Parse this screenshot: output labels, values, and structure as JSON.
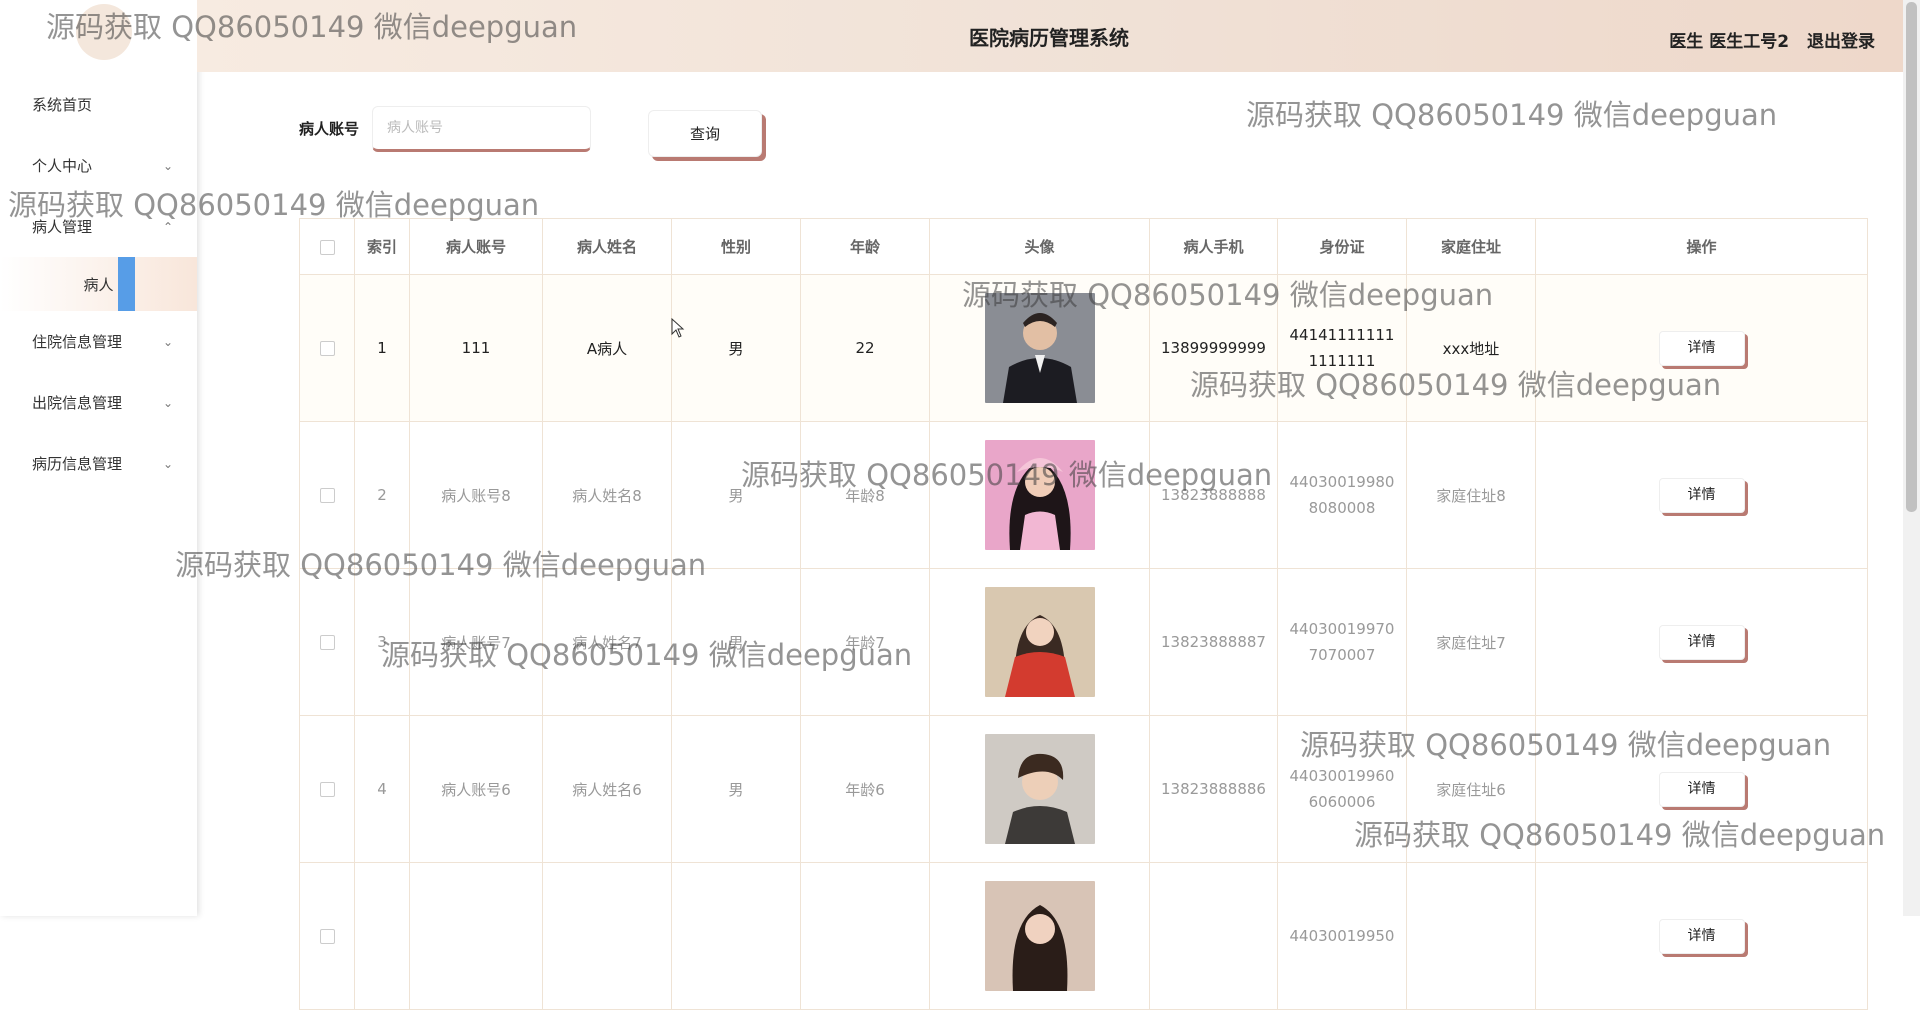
{
  "header": {
    "title": "医院病历管理系统",
    "role": "医生",
    "username": "医生工号2",
    "logout": "退出登录"
  },
  "sidebar": {
    "items": [
      {
        "label": "系统首页"
      },
      {
        "label": "个人中心"
      },
      {
        "label": "病人管理"
      },
      {
        "label": "病人"
      },
      {
        "label": "住院信息管理"
      },
      {
        "label": "出院信息管理"
      },
      {
        "label": "病历信息管理"
      }
    ]
  },
  "search": {
    "label": "病人账号",
    "placeholder": "病人账号",
    "button": "查询"
  },
  "table": {
    "headers": [
      "索引",
      "病人账号",
      "病人姓名",
      "性别",
      "年龄",
      "头像",
      "病人手机",
      "身份证",
      "家庭住址",
      "操作"
    ],
    "detail_label": "详情",
    "rows": [
      {
        "index": "1",
        "account": "111",
        "name": "A病人",
        "gender": "男",
        "age": "22",
        "phone": "13899999999",
        "id_line1": "44141111111",
        "id_line2": "1111111",
        "address": "xxx地址"
      },
      {
        "index": "2",
        "account": "病人账号8",
        "name": "病人姓名8",
        "gender": "男",
        "age": "年龄8",
        "phone": "13823888888",
        "id_line1": "44030019980",
        "id_line2": "8080008",
        "address": "家庭住址8"
      },
      {
        "index": "3",
        "account": "病人账号7",
        "name": "病人姓名7",
        "gender": "男",
        "age": "年龄7",
        "phone": "13823888887",
        "id_line1": "44030019970",
        "id_line2": "7070007",
        "address": "家庭住址7"
      },
      {
        "index": "4",
        "account": "病人账号6",
        "name": "病人姓名6",
        "gender": "男",
        "age": "年龄6",
        "phone": "13823888886",
        "id_line1": "44030019960",
        "id_line2": "6060006",
        "address": "家庭住址6"
      },
      {
        "index": "",
        "account": "",
        "name": "",
        "gender": "",
        "age": "",
        "phone": "",
        "id_line1": "44030019950",
        "id_line2": "",
        "address": ""
      }
    ]
  },
  "watermark": "源码获取 QQ86050149 微信deepguan",
  "colors": {
    "accent": "#b97a72",
    "header_bg": "#f2e3d8",
    "active_bar": "#3a8ee6"
  }
}
